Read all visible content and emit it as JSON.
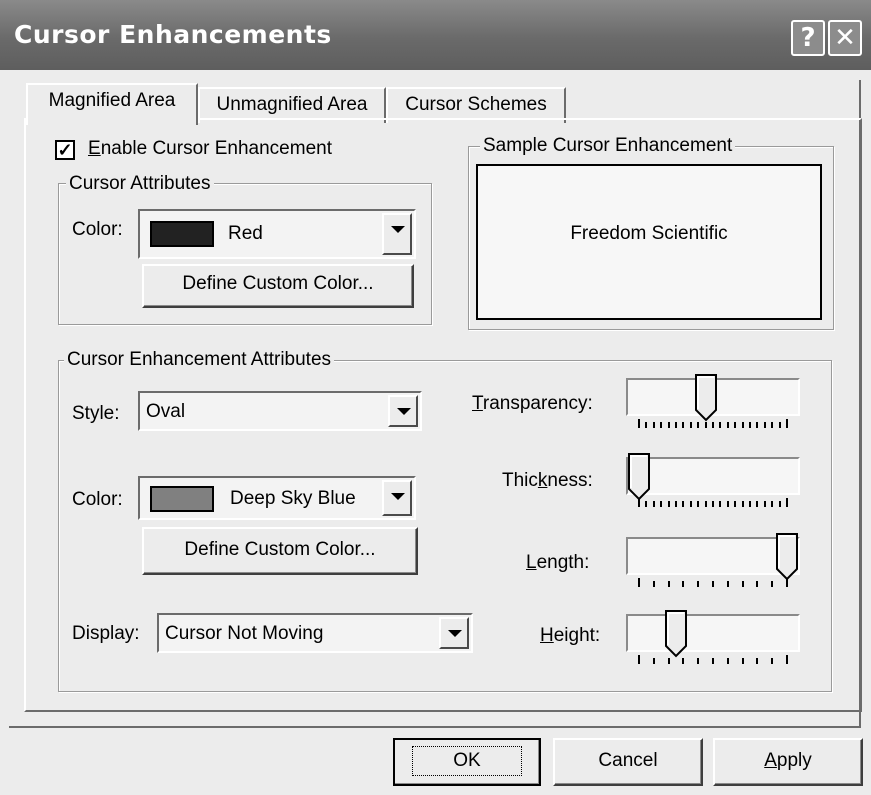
{
  "window": {
    "title": "Cursor Enhancements",
    "help_icon": "help-icon",
    "close_icon": "close-icon"
  },
  "tabs": [
    {
      "label": "Magnified Area",
      "active": true
    },
    {
      "label": "Unmagnified Area",
      "active": false
    },
    {
      "label": "Cursor Schemes",
      "active": false
    }
  ],
  "enable": {
    "label": "Enable Cursor Enhancement",
    "checked": true
  },
  "cursor_attributes": {
    "legend": "Cursor Attributes",
    "color_label": "Color:",
    "color_value": "Red",
    "swatch_color": "#222222",
    "define_button": "Define Custom Color..."
  },
  "sample": {
    "legend": "Sample Cursor Enhancement",
    "text": "Freedom  Scientific"
  },
  "enhancement_attributes": {
    "legend": "Cursor Enhancement Attributes",
    "style_label": "Style:",
    "style_value": "Oval",
    "color_label": "Color:",
    "color_value": "Deep Sky Blue",
    "swatch_color": "#808080",
    "define_button": "Define Custom Color...",
    "display_label": "Display:",
    "display_value": "Cursor Not Moving"
  },
  "sliders": {
    "transparency": {
      "label": "Transparency:",
      "level": 0.45
    },
    "thickness": {
      "label": "Thickness:",
      "level": 0.0
    },
    "length": {
      "label": "Length:",
      "level": 1.0
    },
    "height": {
      "label": "Height:",
      "level": 0.25
    }
  },
  "buttons": {
    "ok": "OK",
    "cancel": "Cancel",
    "apply": "Apply"
  }
}
